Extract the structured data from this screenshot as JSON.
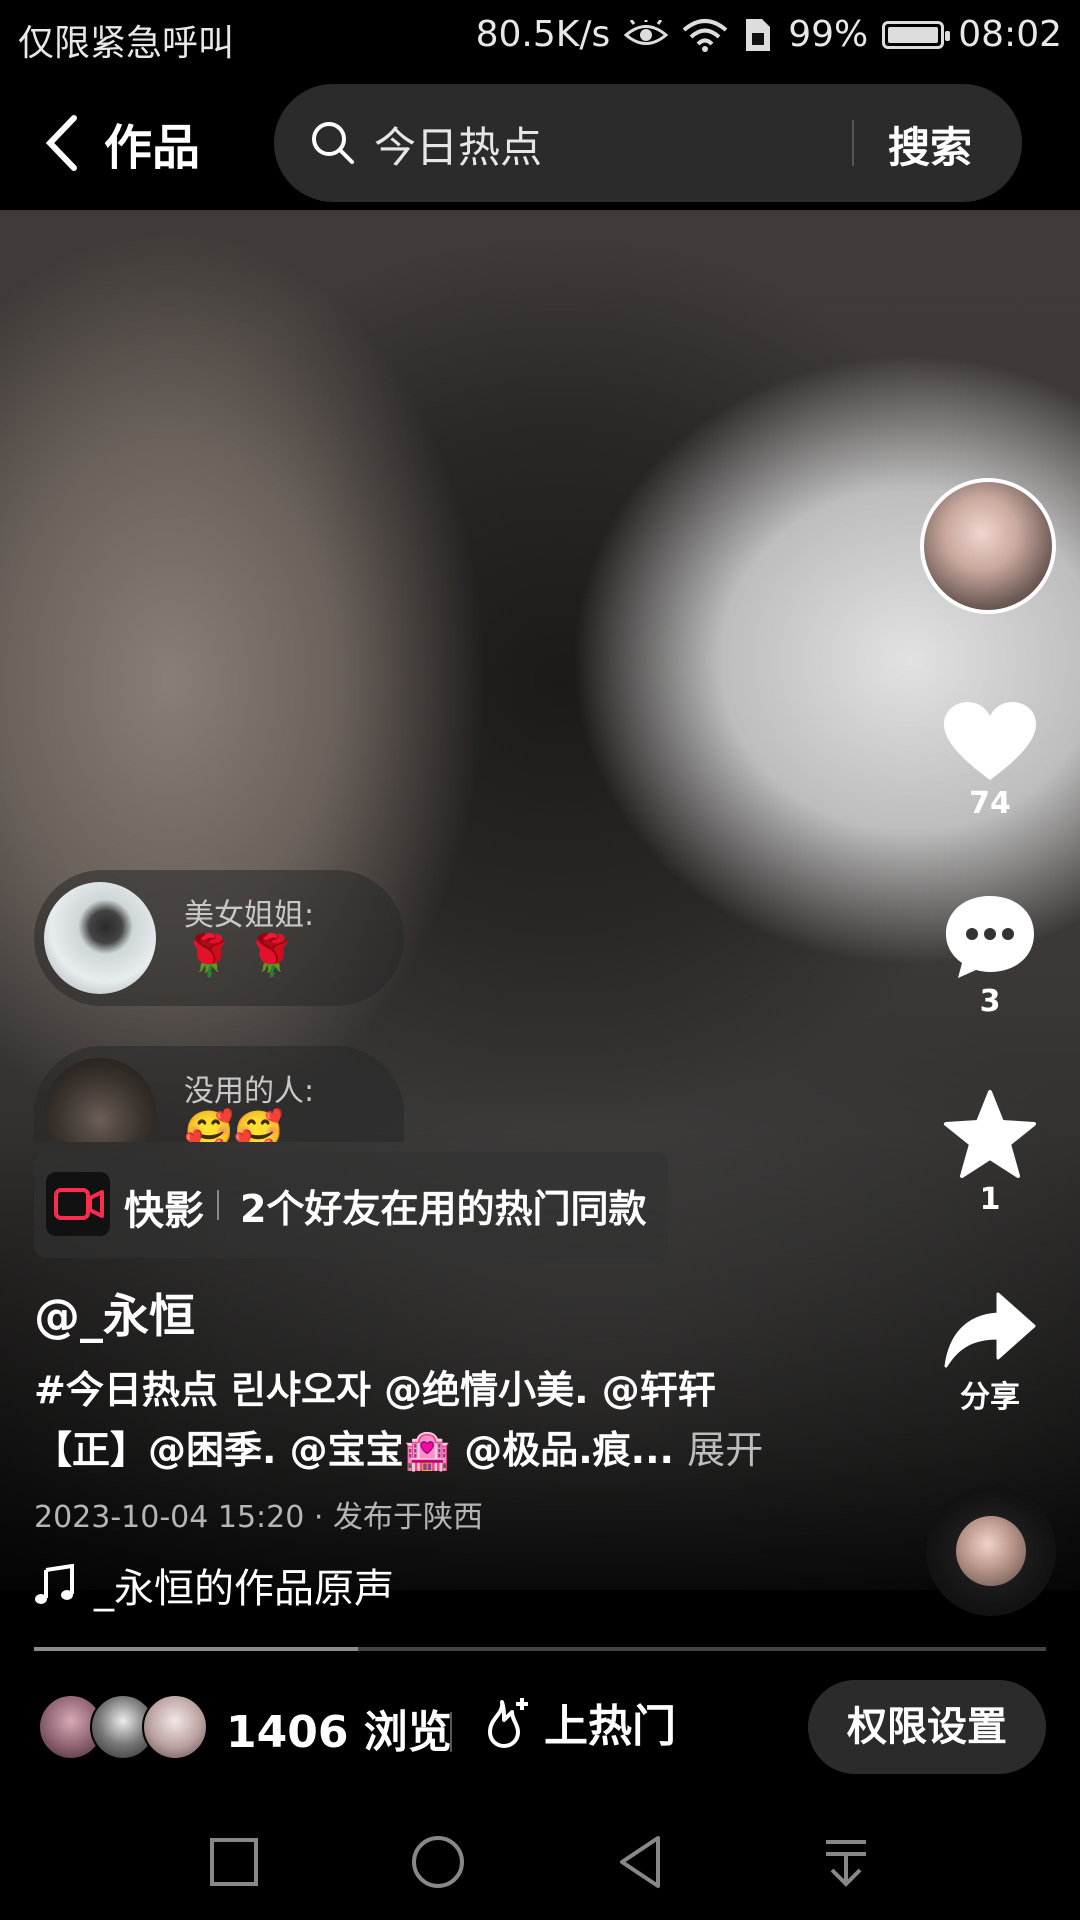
{
  "status_bar": {
    "carrier": "仅限紧急呼叫",
    "speed": "80.5K/s",
    "battery_percent": "99%",
    "battery_level": 0.99,
    "time": "08:02"
  },
  "header": {
    "back_label": "作品",
    "search_value": "今日热点",
    "search_button": "搜索"
  },
  "actions": {
    "likes": "74",
    "comments": "3",
    "favorites": "1",
    "share_label": "分享"
  },
  "danmu": [
    {
      "name": "美女姐姐:",
      "message": "🌹 🌹"
    },
    {
      "name": "没用的人:",
      "message": "🥰🥰"
    }
  ],
  "template": {
    "app": "快影",
    "description": "2个好友在用的热门同款"
  },
  "post": {
    "username": "@_永恒",
    "caption_line1": "#今日热点 린샤오자 @绝情小美. @轩轩",
    "caption_line2": "【正】@困季. @宝宝🏩 @极品.痕...",
    "expand_label": "展开",
    "meta": "2023-10-04 15:20 · 发布于陕西",
    "music": "_永恒的作品原声"
  },
  "progress": {
    "fraction": 0.32
  },
  "bottom": {
    "views": "1406 浏览",
    "promote": "上热门",
    "permission": "权限设置"
  },
  "colors": {
    "background": "#000000",
    "pill": "#2b2b2b",
    "template_icon_red": "#ff2b4f"
  }
}
